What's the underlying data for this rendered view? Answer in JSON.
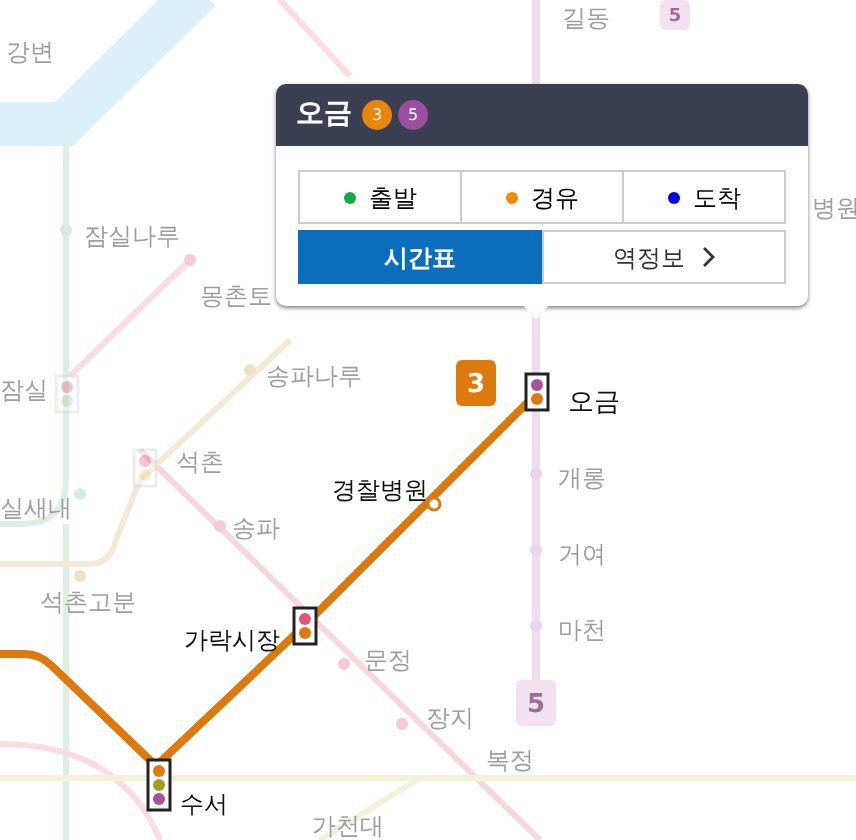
{
  "map": {
    "line_badges": [
      {
        "label": "5",
        "faded": true
      },
      {
        "label": "3",
        "faded": false
      },
      {
        "label": "5",
        "faded": true
      }
    ],
    "stations": [
      {
        "name": "길동",
        "faded": true
      },
      {
        "name": "강변",
        "faded": true
      },
      {
        "name": "병원",
        "faded": true
      },
      {
        "name": "잠실나루",
        "faded": true
      },
      {
        "name": "몽촌토",
        "faded": true
      },
      {
        "name": "송파나루",
        "faded": true
      },
      {
        "name": "잠실",
        "faded": true
      },
      {
        "name": "오금",
        "faded": false
      },
      {
        "name": "석촌",
        "faded": true
      },
      {
        "name": "개롱",
        "faded": true
      },
      {
        "name": "경찰병원",
        "faded": false
      },
      {
        "name": "실새내",
        "faded": true
      },
      {
        "name": "송파",
        "faded": true
      },
      {
        "name": "거여",
        "faded": true
      },
      {
        "name": "석촌고분",
        "faded": true
      },
      {
        "name": "마천",
        "faded": true
      },
      {
        "name": "가락시장",
        "faded": false
      },
      {
        "name": "문정",
        "faded": true
      },
      {
        "name": "장지",
        "faded": true
      },
      {
        "name": "복정",
        "faded": true
      },
      {
        "name": "수서",
        "faded": false
      },
      {
        "name": "가천대",
        "faded": true
      }
    ]
  },
  "popup": {
    "station": "오금",
    "lines": [
      {
        "label": "3",
        "color": "#e8870e"
      },
      {
        "label": "5",
        "color": "#9b4fa0"
      }
    ],
    "options": [
      {
        "label": "출발",
        "color": "#10a94a"
      },
      {
        "label": "경유",
        "color": "#f08a00"
      },
      {
        "label": "도착",
        "color": "#0000e0"
      }
    ],
    "tabs": [
      {
        "label": "시간표",
        "selected": true
      },
      {
        "label": "역정보",
        "selected": false
      }
    ]
  }
}
